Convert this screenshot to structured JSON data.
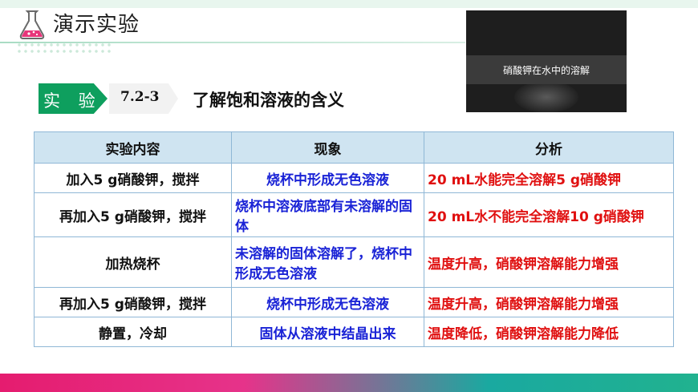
{
  "header": {
    "title": "演示实验"
  },
  "video": {
    "caption": "硝酸钾在水中的溶解"
  },
  "experiment": {
    "tag": "实 验",
    "number": "7.2-3",
    "title": "了解饱和溶液的含义"
  },
  "table": {
    "headers": [
      "实验内容",
      "现象",
      "分析"
    ],
    "rows": [
      {
        "content": "加入5 g硝酸钾，搅拌",
        "phenomenon": "烧杯中形成无色溶液",
        "analysis": "20 mL水能完全溶解5 g硝酸钾"
      },
      {
        "content": "再加入5 g硝酸钾，搅拌",
        "phenomenon": "烧杯中溶液底部有未溶解的固体",
        "analysis": "20 mL水不能完全溶解10 g硝酸钾"
      },
      {
        "content": "加热烧杯",
        "phenomenon": "未溶解的固体溶解了，烧杯中形成无色溶液",
        "analysis": "温度升高，硝酸钾溶解能力增强"
      },
      {
        "content": "再加入5 g硝酸钾，搅拌",
        "phenomenon": "烧杯中形成无色溶液",
        "analysis": "温度升高，硝酸钾溶解能力增强"
      },
      {
        "content": "静置，冷却",
        "phenomenon": "固体从溶液中结晶出来",
        "analysis": "温度降低，硝酸钾溶解能力降低"
      }
    ]
  },
  "colors": {
    "accent": "#0e9f5e",
    "phenomenon": "#1a23d6",
    "analysis": "#e01010",
    "header_bg": "#cfe4f1"
  },
  "icons": {
    "header": "flask-icon"
  }
}
